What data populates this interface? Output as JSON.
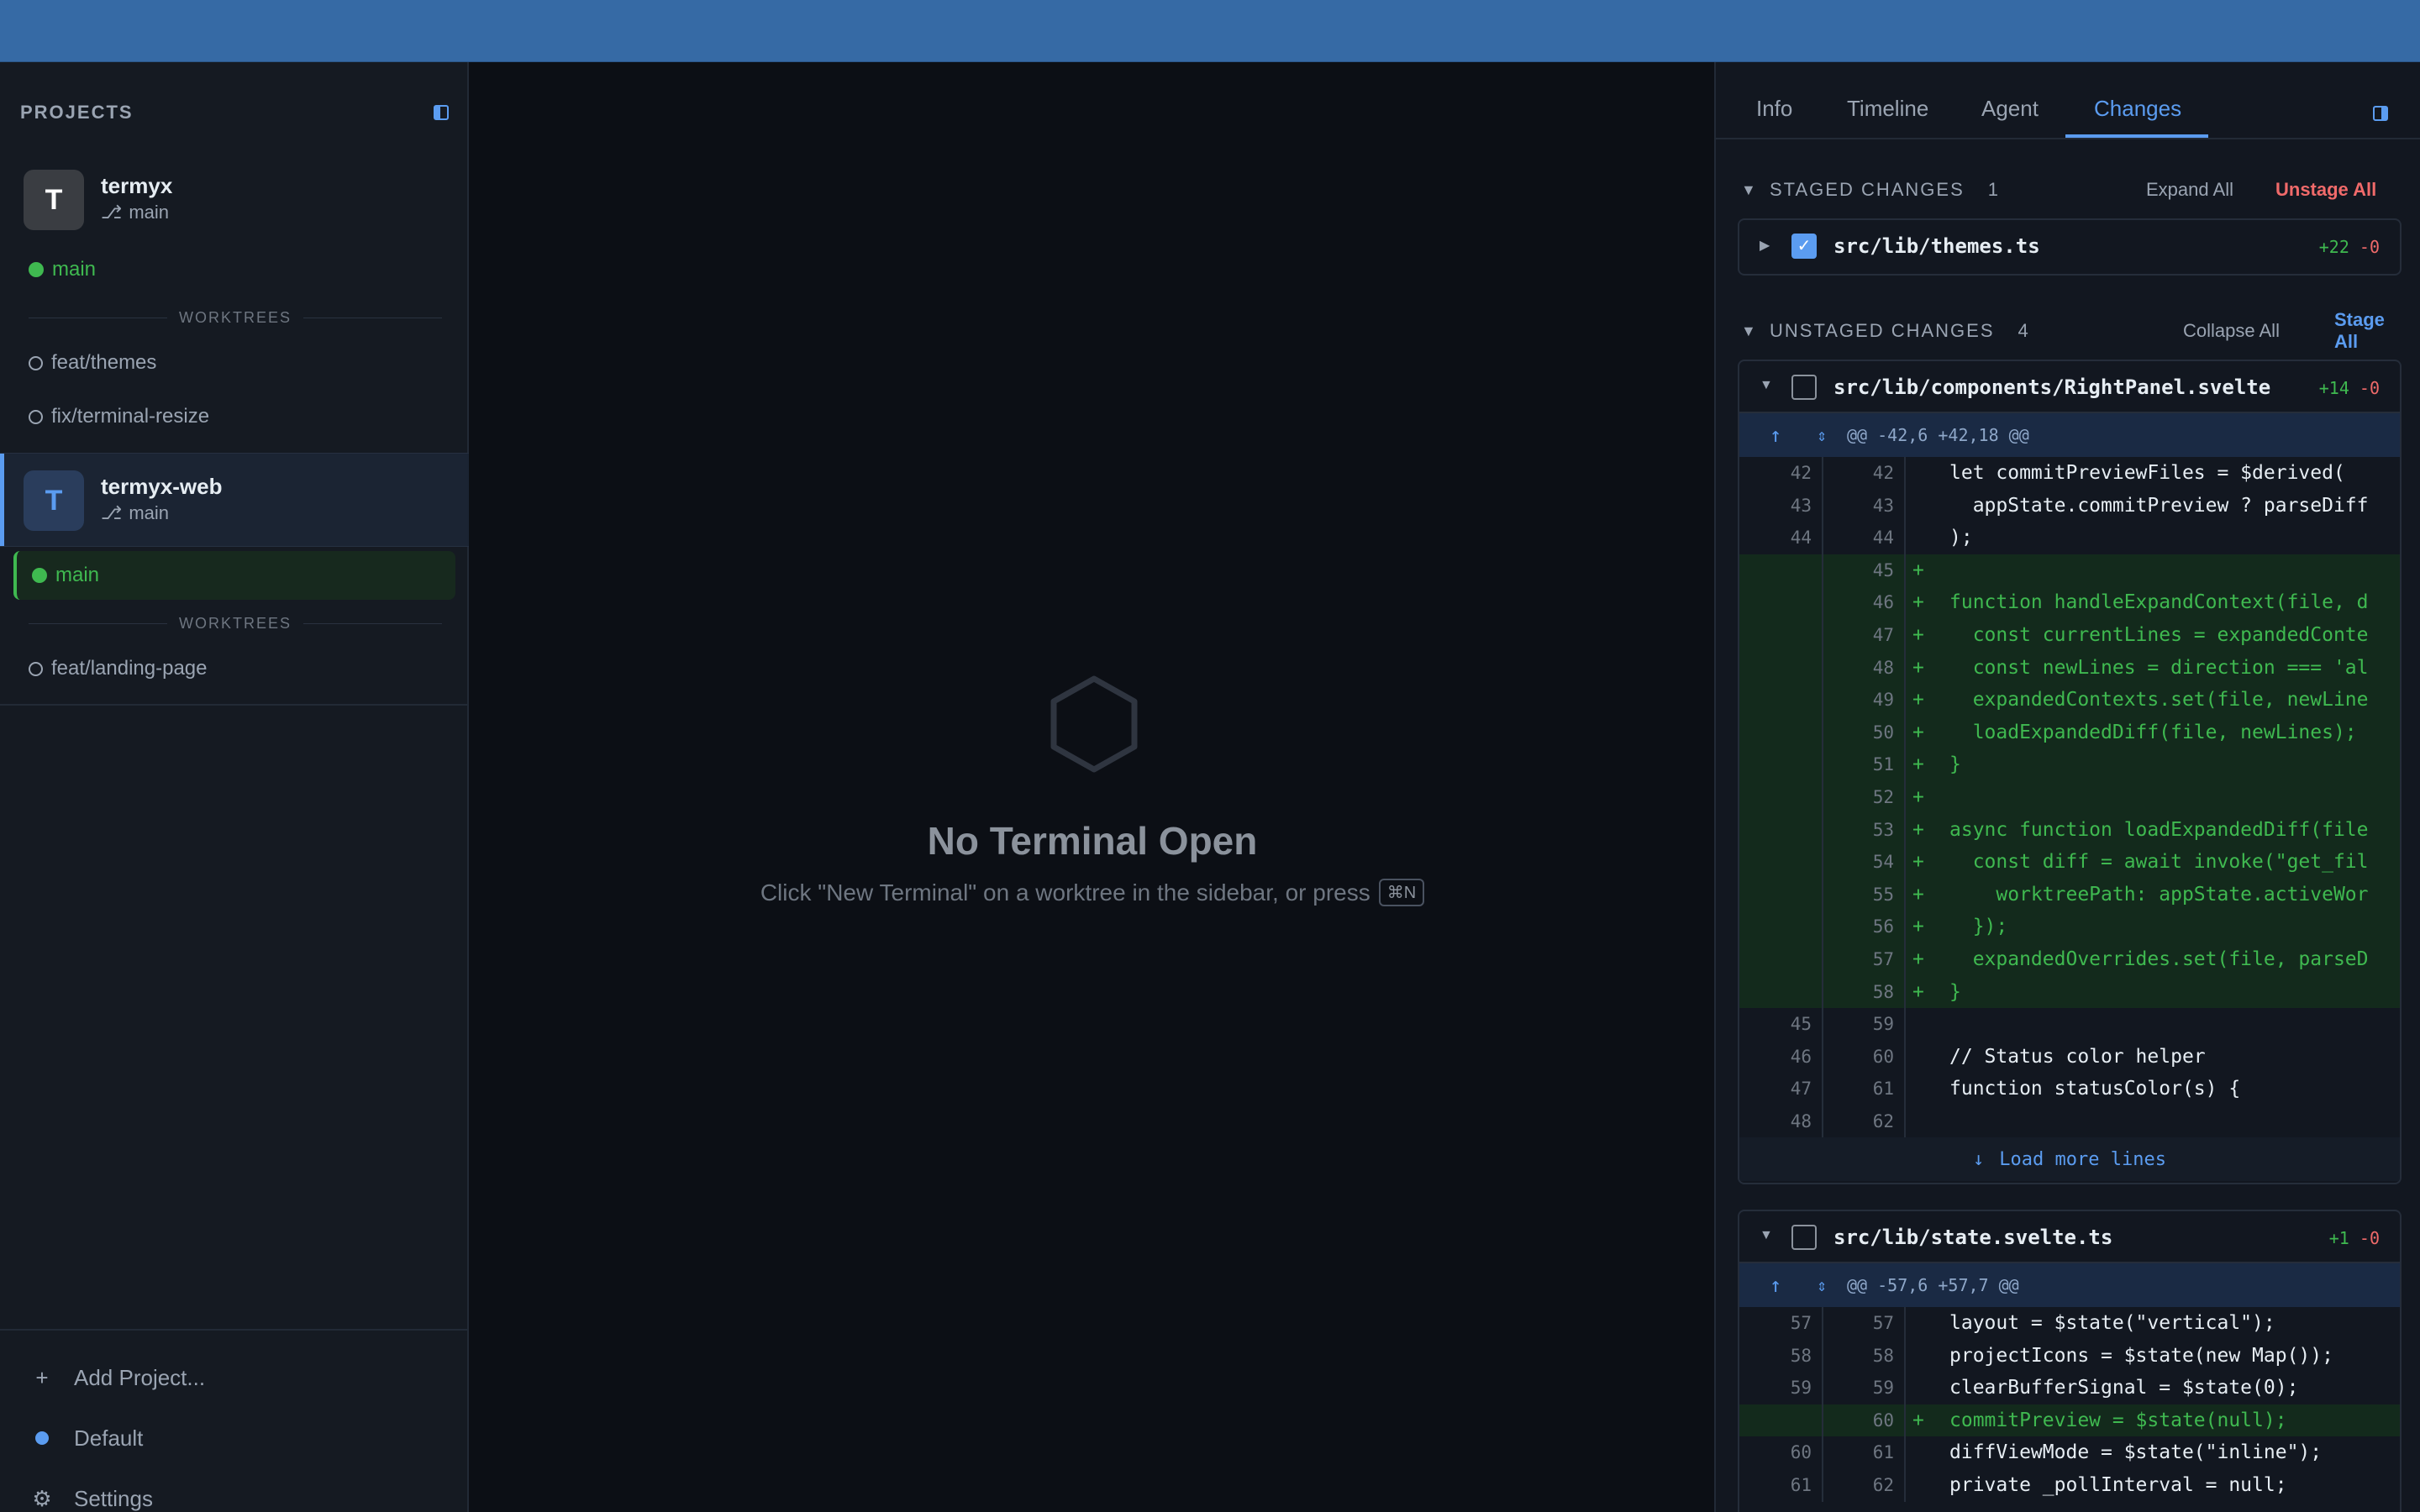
{
  "sidebar": {
    "title": "PROJECTS",
    "projects": [
      {
        "avatar": "T",
        "name": "termyx",
        "branch": "main",
        "main_branch": "main",
        "worktrees_label": "WORKTREES",
        "worktrees": [
          "feat/themes",
          "fix/terminal-resize"
        ]
      },
      {
        "avatar": "T",
        "name": "termyx-web",
        "branch": "main",
        "main_branch": "main",
        "worktrees_label": "WORKTREES",
        "worktrees": [
          "feat/landing-page"
        ]
      }
    ],
    "footer": {
      "add_project": "Add Project...",
      "profile": "Default",
      "settings": "Settings"
    }
  },
  "center": {
    "empty_title": "No Terminal Open",
    "empty_subtitle": "Click \"New Terminal\" on a worktree in the sidebar, or press",
    "shortcut": "⌘N"
  },
  "right_panel": {
    "tabs": [
      "Info",
      "Timeline",
      "Agent",
      "Changes"
    ],
    "active_tab": "Changes",
    "staged": {
      "title": "STAGED CHANGES",
      "count": "1",
      "expand_all": "Expand All",
      "unstage_all": "Unstage All",
      "files": [
        {
          "path": "src/lib/themes.ts",
          "additions": "+22",
          "deletions": "-0",
          "checked": true
        }
      ]
    },
    "unstaged": {
      "title": "UNSTAGED CHANGES",
      "count": "4",
      "collapse_all": "Collapse All",
      "stage_all": "Stage All",
      "files": [
        {
          "path": "src/lib/components/RightPanel.svelte",
          "additions": "+14",
          "deletions": "-0",
          "hunk": "@@ -42,6 +42,18 @@",
          "load_more": "Load more lines",
          "lines": [
            {
              "old": "42",
              "new": "42",
              "sign": "",
              "text": "let commitPreviewFiles = $derived(",
              "type": "ctx"
            },
            {
              "old": "43",
              "new": "43",
              "sign": "",
              "text": "  appState.commitPreview ? parseDiff",
              "type": "ctx"
            },
            {
              "old": "44",
              "new": "44",
              "sign": "",
              "text": ");",
              "type": "ctx"
            },
            {
              "old": "",
              "new": "45",
              "sign": "+",
              "text": "",
              "type": "add"
            },
            {
              "old": "",
              "new": "46",
              "sign": "+",
              "text": "function handleExpandContext(file, d",
              "type": "add"
            },
            {
              "old": "",
              "new": "47",
              "sign": "+",
              "text": "  const currentLines = expandedConte",
              "type": "add"
            },
            {
              "old": "",
              "new": "48",
              "sign": "+",
              "text": "  const newLines = direction === 'al",
              "type": "add"
            },
            {
              "old": "",
              "new": "49",
              "sign": "+",
              "text": "  expandedContexts.set(file, newLine",
              "type": "add"
            },
            {
              "old": "",
              "new": "50",
              "sign": "+",
              "text": "  loadExpandedDiff(file, newLines);",
              "type": "add"
            },
            {
              "old": "",
              "new": "51",
              "sign": "+",
              "text": "}",
              "type": "add"
            },
            {
              "old": "",
              "new": "52",
              "sign": "+",
              "text": "",
              "type": "add"
            },
            {
              "old": "",
              "new": "53",
              "sign": "+",
              "text": "async function loadExpandedDiff(file",
              "type": "add"
            },
            {
              "old": "",
              "new": "54",
              "sign": "+",
              "text": "  const diff = await invoke(\"get_fil",
              "type": "add"
            },
            {
              "old": "",
              "new": "55",
              "sign": "+",
              "text": "    worktreePath: appState.activeWor",
              "type": "add"
            },
            {
              "old": "",
              "new": "56",
              "sign": "+",
              "text": "  });",
              "type": "add"
            },
            {
              "old": "",
              "new": "57",
              "sign": "+",
              "text": "  expandedOverrides.set(file, parseD",
              "type": "add"
            },
            {
              "old": "",
              "new": "58",
              "sign": "+",
              "text": "}",
              "type": "add"
            },
            {
              "old": "45",
              "new": "59",
              "sign": "",
              "text": "",
              "type": "ctx"
            },
            {
              "old": "46",
              "new": "60",
              "sign": "",
              "text": "// Status color helper",
              "type": "ctx"
            },
            {
              "old": "47",
              "new": "61",
              "sign": "",
              "text": "function statusColor(s) {",
              "type": "ctx"
            },
            {
              "old": "48",
              "new": "62",
              "sign": "",
              "text": "",
              "type": "ctx"
            }
          ]
        },
        {
          "path": "src/lib/state.svelte.ts",
          "additions": "+1",
          "deletions": "-0",
          "hunk": "@@ -57,6 +57,7 @@",
          "lines": [
            {
              "old": "57",
              "new": "57",
              "sign": "",
              "text": "layout = $state(\"vertical\");",
              "type": "ctx"
            },
            {
              "old": "58",
              "new": "58",
              "sign": "",
              "text": "projectIcons = $state(new Map());",
              "type": "ctx"
            },
            {
              "old": "59",
              "new": "59",
              "sign": "",
              "text": "clearBufferSignal = $state(0);",
              "type": "ctx"
            },
            {
              "old": "",
              "new": "60",
              "sign": "+",
              "text": "commitPreview = $state(null);",
              "type": "add"
            },
            {
              "old": "60",
              "new": "61",
              "sign": "",
              "text": "diffViewMode = $state(\"inline\");",
              "type": "ctx"
            },
            {
              "old": "61",
              "new": "62",
              "sign": "",
              "text": "private _pollInterval = null;",
              "type": "ctx"
            }
          ]
        }
      ]
    }
  }
}
